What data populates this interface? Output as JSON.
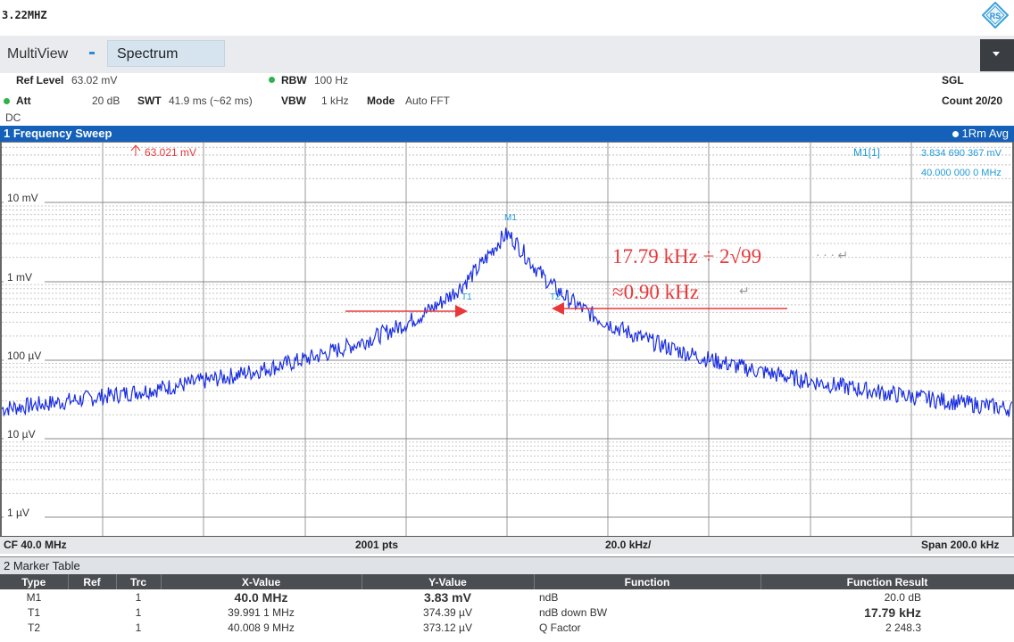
{
  "top": {
    "frequency": "3.22MHZ"
  },
  "tabs": {
    "multiview": "MultiView",
    "spectrum": "Spectrum"
  },
  "settings": {
    "ref_level_label": "Ref Level",
    "ref_level_value": "63.02 mV",
    "att_label": "Att",
    "att_value": "20 dB",
    "swt_label": "SWT",
    "swt_value": "41.9 ms (~62 ms)",
    "rbw_label": "RBW",
    "rbw_value": "100 Hz",
    "vbw_label": "VBW",
    "vbw_value": "1 kHz",
    "mode_label": "Mode",
    "mode_value": "Auto FFT",
    "coupling": "DC",
    "sweep_mode": "SGL",
    "count": "Count 20/20"
  },
  "trace": {
    "title": "1 Frequency Sweep",
    "detector": "1Rm Avg",
    "ref_marker": "63.021 mV",
    "marker_label": "M1[1]",
    "marker_value": "3.834 690 367 mV",
    "marker_freq": "40.000 000 0 MHz",
    "y_labels": [
      "10 mV",
      "1 mV",
      "100 µV",
      "10 µV",
      "1 µV"
    ],
    "m1": "M1",
    "t1": "T1",
    "t2": "T2"
  },
  "annotation": {
    "line1": "17.79 kHz ÷ 2√99",
    "line2": "≈0.90 kHz"
  },
  "bottom": {
    "cf": "CF 40.0 MHz",
    "pts": "2001 pts",
    "div": "20.0 kHz/",
    "span": "Span 200.0 kHz"
  },
  "marker_table": {
    "title": "2 Marker Table",
    "headers": [
      "Type",
      "Ref",
      "Trc",
      "X-Value",
      "Y-Value",
      "Function",
      "Function Result"
    ],
    "rows": [
      {
        "type": "M1",
        "ref": "",
        "trc": "1",
        "x": "40.0 MHz",
        "y": "3.83 mV",
        "function": "ndB",
        "result": "20.0 dB"
      },
      {
        "type": "T1",
        "ref": "",
        "trc": "1",
        "x": "39.991 1 MHz",
        "y": "374.39 µV",
        "function": "ndB down BW",
        "result": "17.79 kHz"
      },
      {
        "type": "T2",
        "ref": "",
        "trc": "1",
        "x": "40.008 9 MHz",
        "y": "373.12 µV",
        "function": "Q Factor",
        "result": "2 248.3"
      }
    ]
  },
  "colors": {
    "trace": "#1a2ee0",
    "title_bar": "#1560b8",
    "marker": "#1e9ad6",
    "annotation": "#e8383a"
  },
  "chart_data": {
    "type": "line",
    "title": "1 Frequency Sweep",
    "xlabel": "",
    "ylabel": "",
    "x_range_mhz": [
      39.9,
      40.1
    ],
    "y_scale": "log",
    "y_range_v": [
      1e-06,
      0.06302
    ],
    "y_ticks": [
      "10 mV",
      "1 mV",
      "100 µV",
      "10 µV",
      "1 µV"
    ],
    "series": [
      {
        "values_desc": [],
        "x": [
          39.9,
          39.92,
          39.94,
          39.96,
          39.98,
          39.99,
          39.9955,
          40.0,
          40.0045,
          40.01,
          40.02,
          40.04,
          40.06,
          40.08,
          40.1
        ],
        "y_uV": [
          13,
          17,
          28,
          50,
          130,
          374,
          1100,
          3835,
          1100,
          373,
          130,
          50,
          28,
          17,
          13
        ]
      }
    ],
    "grid": true,
    "legend": "none"
  }
}
